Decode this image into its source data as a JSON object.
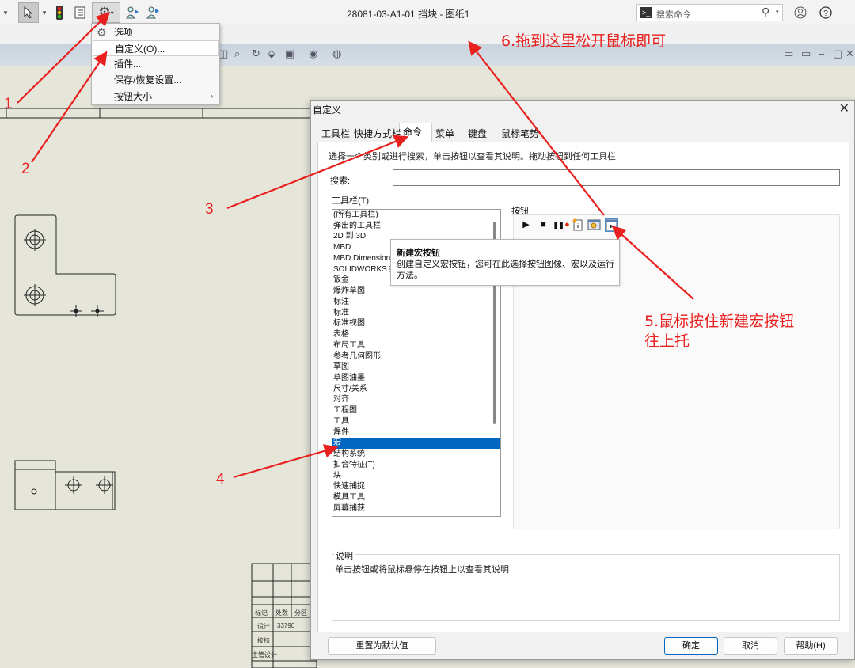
{
  "window": {
    "title": "28081-03-A1-01 挡块 - 图纸1",
    "search_placeholder": "搜索命令"
  },
  "context_menu": {
    "items": [
      {
        "label": "选项",
        "highlighted": false
      },
      {
        "label": "自定义(O)...",
        "highlighted": true
      },
      {
        "label": "插件...",
        "highlighted": false
      },
      {
        "label": "保存/恢复设置...",
        "highlighted": false
      },
      {
        "label": "按钮大小",
        "highlighted": false,
        "submenu": true
      }
    ]
  },
  "dialog": {
    "title": "自定义",
    "tabs": [
      "工具栏",
      "快捷方式栏",
      "命令",
      "菜单",
      "键盘",
      "鼠标笔势"
    ],
    "active_tab": "命令",
    "instruction": "选择一个类别或进行搜索，单击按钮以查看其说明。拖动按钮到任何工具栏",
    "search_label": "搜索:",
    "search_value": "",
    "toolbars_label": "工具栏(T):",
    "toolbars": [
      "(所有工具栏)",
      "弹出的工具栏",
      "2D 到 3D",
      "MBD",
      "MBD Dimension",
      "SOLIDWORKS 插件",
      "钣金",
      "爆炸草图",
      "标注",
      "标准",
      "标准视图",
      "表格",
      "布局工具",
      "参考几何图形",
      "草图",
      "草图油墨",
      "尺寸/关系",
      "对齐",
      "工程图",
      "工具",
      "焊件",
      "宏",
      "结构系统",
      "扣合特征(T)",
      "块",
      "快速捕捉",
      "模具工具",
      "屏幕捕获"
    ],
    "selected_toolbar": "宏",
    "buttons_label": "按钮",
    "button_icons": [
      "play-icon",
      "stop-icon",
      "pause-record-icon",
      "edit-macro-icon",
      "new-macro-icon",
      "new-macro-button-icon"
    ],
    "description_label": "说明",
    "description_text": "单击按钮或将鼠标悬停在按钮上以查看其说明",
    "footer": {
      "reset": "重置为默认值",
      "ok": "确定",
      "cancel": "取消",
      "help": "帮助(H)"
    }
  },
  "tooltip": {
    "title": "新建宏按钮",
    "body": "创建自定义宏按钮，您可在此选择按钮图像、宏以及运行方法。"
  },
  "annotations": {
    "a1": "1",
    "a2": "2",
    "a3": "3",
    "a4": "4",
    "a5_line1": "5.鼠标按住新建宏按钮",
    "a5_line2": "往上托",
    "a6": "6.拖到这里松开鼠标即可"
  },
  "drawing": {
    "title_block": [
      "标记",
      "处数",
      "分区",
      "设计",
      "33790",
      "校核",
      "主管设计"
    ]
  },
  "colors": {
    "accent": "#0067c0",
    "annotation": "#e8201f"
  }
}
